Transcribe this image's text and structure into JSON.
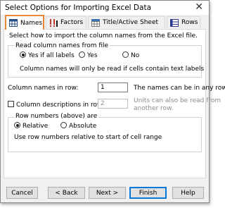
{
  "window": {
    "title": "Select Options for Importing Excel Data",
    "close_symbol": "✕"
  },
  "tabs": [
    {
      "label": "Names",
      "icon": "names-icon",
      "active": true
    },
    {
      "label": "Factors",
      "icon": "factors-icon",
      "active": false
    },
    {
      "label": "Title/Active Sheet",
      "icon": "title-icon",
      "active": false
    },
    {
      "label": "Rows",
      "icon": "rows-icon",
      "active": false
    }
  ],
  "names_tab": {
    "instruction": "Select how to import the column names from the Excel file.",
    "read_group": {
      "title": "Read column names from file",
      "options": [
        "Yes if all labels",
        "Yes",
        "No"
      ],
      "selected": "Yes if all labels",
      "note": "Column names will only be read if cells contain text labels"
    },
    "column_names_row": {
      "label": "Column names in row:",
      "value": "1",
      "hint": "The names can be in any row."
    },
    "descriptions_row": {
      "label": "Column descriptions in row:",
      "checked": false,
      "value": "2",
      "hint_line1": "Units can also be read from",
      "hint_line2": "another row."
    },
    "row_numbers_group": {
      "title": "Row numbers (above) are",
      "options": [
        "Relative",
        "Absolute"
      ],
      "selected": "Relative",
      "note": "Use row numbers relative to start of cell range"
    }
  },
  "buttons": {
    "cancel": "Cancel",
    "back": "< Back",
    "next": "Next >",
    "finish": "Finish",
    "help": "Help"
  },
  "colors": {
    "active_tab_border": "#e8883a",
    "factors_icon": "#c0392b",
    "rows_icon": "#2b3a8c"
  }
}
